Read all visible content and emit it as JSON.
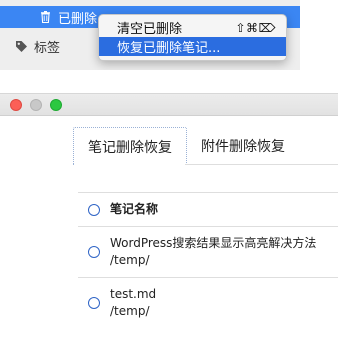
{
  "sidebar": {
    "trash_label": "已删除",
    "trash_icon": "trash-icon",
    "tags_label": "标签",
    "tags_icon": "tag-icon",
    "selected_color": "#3b86f3"
  },
  "context_menu": {
    "items": [
      {
        "label": "清空已删除",
        "shortcut": "⇧⌘⌦"
      },
      {
        "label": "恢复已删除笔记...",
        "shortcut": ""
      }
    ],
    "selected_color": "#2b6de0"
  },
  "window": {
    "tabs": [
      "笔记删除恢复",
      "附件删除恢复"
    ],
    "table": {
      "header": "笔记名称",
      "rows": [
        {
          "name": "WordPress搜索结果显示高亮解决方法",
          "path": "/temp/"
        },
        {
          "name": "test.md",
          "path": "/temp/"
        }
      ]
    }
  }
}
